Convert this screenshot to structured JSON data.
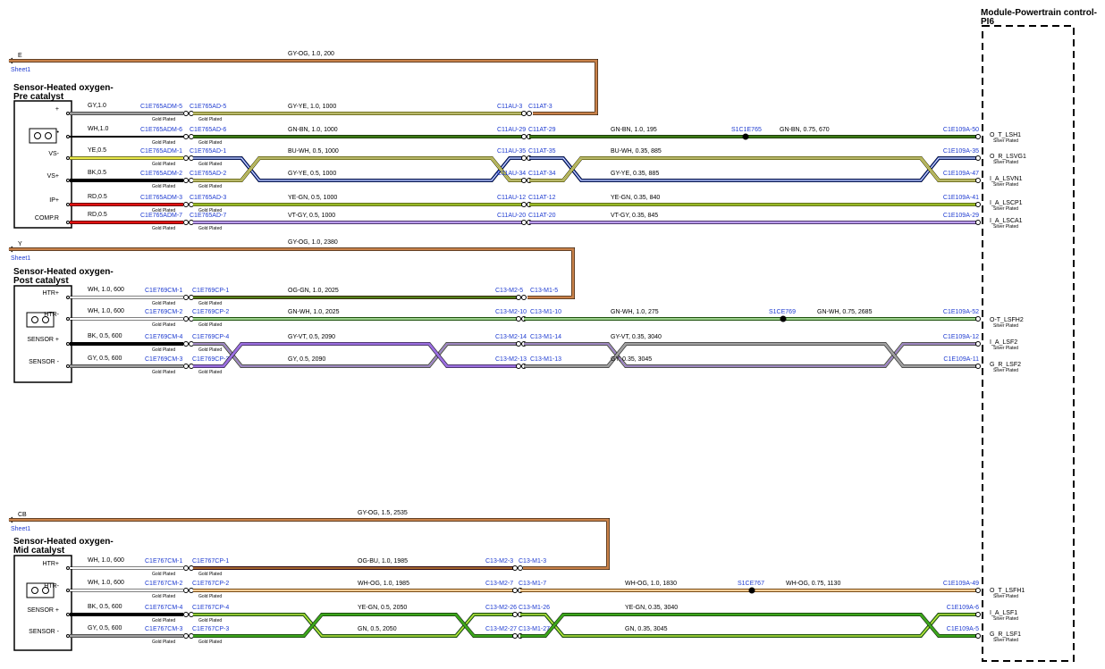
{
  "module": {
    "title_line1": "Module-Powertrain control-",
    "title_line2": "PI6"
  },
  "pre": {
    "title_line1": "Sensor-Heated oxygen-",
    "title_line2": "Pre catalyst",
    "ref": {
      "letter": "E",
      "sheet": "Sheet1",
      "label": "GY-OG,  1.0,  200"
    },
    "pins": {
      "plus": "+",
      "dot": "•",
      "vsm": "VS-",
      "vsp": "VS+",
      "ipp": "IP+",
      "comp": "COMP.R"
    },
    "wires": [
      {
        "lead": "GY,1.0",
        "conn1": "C1E765ADM-5",
        "conn2": "C1E765AD-5",
        "mid": "GY-YE,  1.0,  1000",
        "c3": "C11AU-3",
        "c4": "C11AT-3"
      },
      {
        "lead": "WH,1.0",
        "conn1": "C1E765ADM-6",
        "conn2": "C1E765AD-6",
        "mid": "GN-BN,  1.0,  1000",
        "c3": "C11AU-29",
        "c4": "C11AT-29",
        "right": "GN-BN,  1.0,  195",
        "splice": "S1C1E765",
        "right2": "GN-BN,  0.75,  670",
        "pcm": "C1E109A-50",
        "sig": "O_T_LSH1"
      },
      {
        "lead": "YE,0.5",
        "conn1": "C1E765ADM-1",
        "conn2": "C1E765AD-1",
        "mid": "BU-WH,  0.5,  1000",
        "c3": "C11AU-35",
        "c4": "C11AT-35",
        "right": "BU-WH,  0.35,  885",
        "pcm": "C1E109A-35",
        "sig": "O_R_LSVG1"
      },
      {
        "lead": "BK,0.5",
        "conn1": "C1E765ADM-2",
        "conn2": "C1E765AD-2",
        "mid": "GY-YE,  0.5,  1000",
        "c3": "C11AU-34",
        "c4": "C11AT-34",
        "right": "GY-YE,  0.35,  885",
        "pcm": "C1E109A-47",
        "sig": "I_A_LSVN1"
      },
      {
        "lead": "RD,0.5",
        "conn1": "C1E765ADM-3",
        "conn2": "C1E765AD-3",
        "mid": "YE-GN,  0.5,  1000",
        "c3": "C11AU-12",
        "c4": "C11AT-12",
        "right": "YE-GN,  0.35,  840",
        "pcm": "C1E109A-41",
        "sig": "I_A_LSCP1"
      },
      {
        "lead": "RD,0.5",
        "conn1": "C1E765ADM-7",
        "conn2": "C1E765AD-7",
        "mid": "VT-GY,  0.5,  1000",
        "c3": "C11AU-20",
        "c4": "C11AT-20",
        "right": "VT-GY,  0.35,  845",
        "pcm": "C1E109A-29",
        "sig": "I_A_LSCA1"
      }
    ]
  },
  "post": {
    "title_line1": "Sensor-Heated oxygen-",
    "title_line2": "Post catalyst",
    "ref": {
      "letter": "Y",
      "sheet": "Sheet1",
      "label": "GY-OG,  1.0,  2380"
    },
    "pins": {
      "htrp": "HTR+",
      "htrm": "HTR-",
      "senp": "SENSOR +",
      "senm": "SENSOR -"
    },
    "wires": [
      {
        "lead": "WH,  1.0,  600",
        "conn1": "C1E769CM-1",
        "conn2": "C1E769CP-1",
        "mid": "OG-GN,  1.0,  2025",
        "c3": "C13-M2-5",
        "c4": "C13-M1-5"
      },
      {
        "lead": "WH,  1.0,  600",
        "conn1": "C1E769CM-2",
        "conn2": "C1E769CP-2",
        "mid": "GN-WH,  1.0,  2025",
        "c3": "C13-M2-10",
        "c4": "C13-M1-10",
        "right": "GN-WH,  1.0,  275",
        "splice": "S1CE769",
        "right2": "GN-WH,  0.75,  2685",
        "pcm": "C1E109A-52",
        "sig": "O-T_LSFH2"
      },
      {
        "lead": "BK,  0.5,  600",
        "conn1": "C1E769CM-4",
        "conn2": "C1E769CP-4",
        "mid": "GY-VT,  0.5,  2090",
        "c3": "C13-M2-14",
        "c4": "C13-M1-14",
        "right": "GY-VT,  0.35,  3040",
        "pcm": "C1E109A-12",
        "sig": "I_A_LSF2"
      },
      {
        "lead": "GY,  0.5,  600",
        "conn1": "C1E769CM-3",
        "conn2": "C1E769CP-3",
        "mid": "GY,  0.5,  2090",
        "c3": "C13-M2-13",
        "c4": "C13-M1-13",
        "right": "GY,  0.35,  3045",
        "pcm": "C1E109A-11",
        "sig": "G_R_LSF2"
      }
    ]
  },
  "mid": {
    "title_line1": "Sensor-Heated oxygen-",
    "title_line2": "Mid catalyst",
    "ref": {
      "letter": "CB",
      "sheet": "Sheet1",
      "label": "GY-OG,  1.5,  2535"
    },
    "pins": {
      "htrp": "HTR+",
      "htrm": "HTR-",
      "senp": "SENSOR +",
      "senm": "SENSOR -"
    },
    "wires": [
      {
        "lead": "WH,  1.0,  600",
        "conn1": "C1E767CM-1",
        "conn2": "C1E767CP-1",
        "mid": "OG-BU,  1.0,  1985",
        "c3": "C13-M2-3",
        "c4": "C13-M1-3"
      },
      {
        "lead": "WH,  1.0,  600",
        "conn1": "C1E767CM-2",
        "conn2": "C1E767CP-2",
        "mid": "WH-OG,  1.0,  1985",
        "c3": "C13-M2-7",
        "c4": "C13-M1-7",
        "right": "WH-OG,  1.0,  1830",
        "splice": "S1CE767",
        "right2": "WH-OG,  0.75,  1130",
        "pcm": "C1E109A-49",
        "sig": "O_T_LSFH1"
      },
      {
        "lead": "BK,  0.5,  600",
        "conn1": "C1E767CM-4",
        "conn2": "C1E767CP-4",
        "mid": "YE-GN,  0.5,  2050",
        "c3": "C13-M2-26",
        "c4": "C13-M1-26",
        "right": "YE-GN,  0.35,  3040",
        "pcm": "C1E109A-6",
        "sig": "I_A_LSF1"
      },
      {
        "lead": "GY,  0.5,  600",
        "conn1": "C1E767CM-3",
        "conn2": "C1E767CP-3",
        "mid": "GN,  0.5,  2050",
        "c3": "C13-M2-27",
        "c4": "C13-M1-27",
        "right": "GN,  0.35,  3045",
        "pcm": "C1E109A-5",
        "sig": "G_R_LSF1"
      }
    ]
  },
  "labels": {
    "gold": "Gold Plated",
    "silver": "Silver Plated"
  },
  "colors": {
    "orange": "#d98c3a",
    "ref": "#c9824a",
    "blue_text": "#1f3cd1",
    "yellow": "#e8e84a",
    "green_dark": "#3d7a16",
    "green": "#3ca51c",
    "navy": "#1230a6",
    "lime": "#c7e83a",
    "purple": "#9b6fe0",
    "grey": "#a0a0a0",
    "black": "#000000",
    "red": "#e01010"
  }
}
